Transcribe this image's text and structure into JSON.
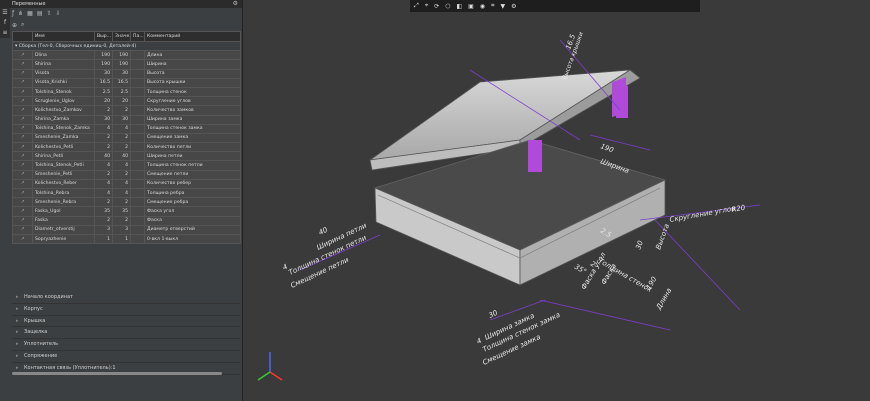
{
  "panel": {
    "title": "Переменные",
    "toolbar_icons": [
      "fx-icon",
      "tree-icon",
      "table-icon",
      "filter-icon",
      "arrow-up-icon",
      "arrow-down-icon"
    ],
    "columns": [
      "Имя",
      "Выр...",
      "Значе...",
      "Па...",
      "Комментарий"
    ],
    "group_label": "Сборка (Тел-0, Сборочных единиц-0, Деталей-4)",
    "rows": [
      {
        "name": "Dlina",
        "expr": "190",
        "value": "190",
        "comment": "Длина"
      },
      {
        "name": "Shirina",
        "expr": "190",
        "value": "190",
        "comment": "Ширина"
      },
      {
        "name": "Visota",
        "expr": "30",
        "value": "30",
        "comment": "Высота"
      },
      {
        "name": "Visota_Krishki",
        "expr": "16.5",
        "value": "16.5",
        "comment": "Высота крышки"
      },
      {
        "name": "Tolshina_Stenok",
        "expr": "2.5",
        "value": "2.5",
        "comment": "Толщина стенок"
      },
      {
        "name": "Scruglenie_Uglov",
        "expr": "20",
        "value": "20",
        "comment": "Скругление углов"
      },
      {
        "name": "Kolichestvo_Zamkov",
        "expr": "2",
        "value": "2",
        "comment": "Количество замков"
      },
      {
        "name": "Shirina_Zamka",
        "expr": "30",
        "value": "30",
        "comment": "Ширина замка"
      },
      {
        "name": "Tolshina_Stenok_Zamka",
        "expr": "4",
        "value": "4",
        "comment": "Толщина стенок замка"
      },
      {
        "name": "Smeshenie_Zamka",
        "expr": "2",
        "value": "2",
        "comment": "Смещение замка"
      },
      {
        "name": "Kolichestvo_Petli",
        "expr": "2",
        "value": "2",
        "comment": "Количество петли"
      },
      {
        "name": "Shirina_Petli",
        "expr": "40",
        "value": "40",
        "comment": "Ширина петли"
      },
      {
        "name": "Tolshina_Stenok_Petli",
        "expr": "4",
        "value": "4",
        "comment": "Толщина стенок петли"
      },
      {
        "name": "Smeshenie_Petli",
        "expr": "2",
        "value": "2",
        "comment": "Смещение петли"
      },
      {
        "name": "Kolichestvo_Reber",
        "expr": "4",
        "value": "4",
        "comment": "Количество ребер"
      },
      {
        "name": "Tolshina_Rebra",
        "expr": "4",
        "value": "4",
        "comment": "Толщина ребра"
      },
      {
        "name": "Smeshenie_Rebra",
        "expr": "2",
        "value": "2",
        "comment": "Смещение ребра"
      },
      {
        "name": "Faska_Ugol",
        "expr": "35",
        "value": "35",
        "comment": "Фаска угол"
      },
      {
        "name": "Faska",
        "expr": "2",
        "value": "2",
        "comment": "Фаска"
      },
      {
        "name": "Diametr_otverstij",
        "expr": "3",
        "value": "3",
        "comment": "Диаметр отверстий"
      },
      {
        "name": "Sopryazhenie",
        "expr": "1",
        "value": "1",
        "comment": "0-вкл 1-выкл"
      }
    ],
    "sections": [
      "Начало координат",
      "Корпус",
      "Крышка",
      "Защелка",
      "Уплотнитель",
      "Сопряжение",
      "Контактная связь (Уплотнитель):1"
    ]
  },
  "viewport": {
    "dimensions": {
      "lid_height": "16.5",
      "lid_height_label": "Высота крышки",
      "width_value": "190",
      "width_label": "Ширина",
      "radius_value": "R20",
      "radius_label": "Скругление углов",
      "wall_value": "2.5",
      "wall_label": "Толщина стенок",
      "height_value": "30",
      "height_label": "Высота",
      "length_value": "190",
      "length_label": "Длина",
      "hinge_width_value": "40",
      "hinge_width_label": "Ширина петли",
      "hinge_wall_value": "4",
      "hinge_wall_label": "Толщина стенок петли",
      "hinge_shift_label": "Смещение петли",
      "lock_width_value": "30",
      "lock_width_label": "Ширина замка",
      "lock_wall_value": "4",
      "lock_wall_label": "Толщина стенок замка",
      "lock_shift_label": "Смещение замка",
      "chamfer_value": "2",
      "chamfer_label": "Фаска",
      "chamfer_angle_value": "35°",
      "chamfer_angle_label": "Фаска угол"
    },
    "colors": {
      "dimension": "#7b3fd0",
      "model": "#c8c8c8",
      "hinge": "#b04ad8",
      "background": "#3a3a3a"
    }
  }
}
